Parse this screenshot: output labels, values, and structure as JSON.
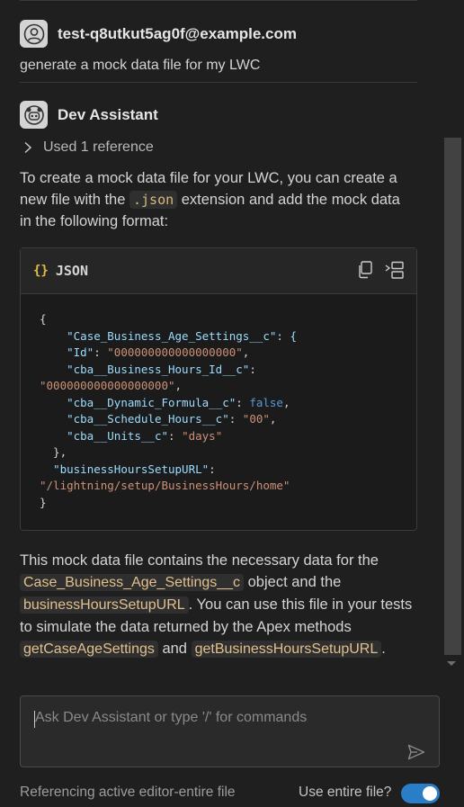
{
  "conversation": {
    "user": {
      "name": "test-q8utkut5ag0f@example.com",
      "message": "generate a mock data file for my LWC"
    },
    "assistant": {
      "name": "Dev Assistant",
      "reference_label": "Used 1 reference",
      "intro": {
        "before": "To create a mock data file for your LWC, you can create a new file with the ",
        "code": ".json",
        "after": " extension and add the mock data in the following format:"
      },
      "code_block": {
        "icon": "{}",
        "language": "JSON",
        "copy_icon": "copy-icon",
        "insert_icon": "insert-at-cursor-icon",
        "lines": [
          "{",
          "  \"Case_Business_Age_Settings__c\": {",
          "    \"Id\": \"000000000000000000\",",
          "    \"cba__Business_Hours_Id__c\":",
          "\"000000000000000000\",",
          "    \"cba__Dynamic_Formula__c\": false,",
          "    \"cba__Schedule_Hours__c\": \"00\",",
          "    \"cba__Units__c\": \"days\"",
          "  },",
          "  \"businessHoursSetupURL\":",
          "\"/lightning/setup/BusinessHours/home\"",
          "}"
        ]
      },
      "outro": {
        "t1": "This mock data file contains the necessary data for the ",
        "c1": "Case_Business_Age_Settings__c",
        "t2": " object and the ",
        "c2": "businessHoursSetupURL",
        "t3": ". You can use this file in your tests to simulate the data returned by the Apex methods ",
        "c3": "getCaseAgeSettings",
        "t4": " and ",
        "c4": "getBusinessHoursSetupURL",
        "t5": "."
      }
    }
  },
  "composer": {
    "placeholder": "Ask Dev Assistant or type '/' for commands",
    "send_icon": "send-icon"
  },
  "footer": {
    "context_label": "Referencing active editor-entire file",
    "toggle_label": "Use entire file?",
    "toggle_on": true
  },
  "colors": {
    "background": "#1f1f1f",
    "accent": "#2a7ec8",
    "inline_code": "#d7ba7d",
    "json_key": "#9cdcfe",
    "json_string": "#ce9178",
    "json_boolean": "#569cd6"
  }
}
